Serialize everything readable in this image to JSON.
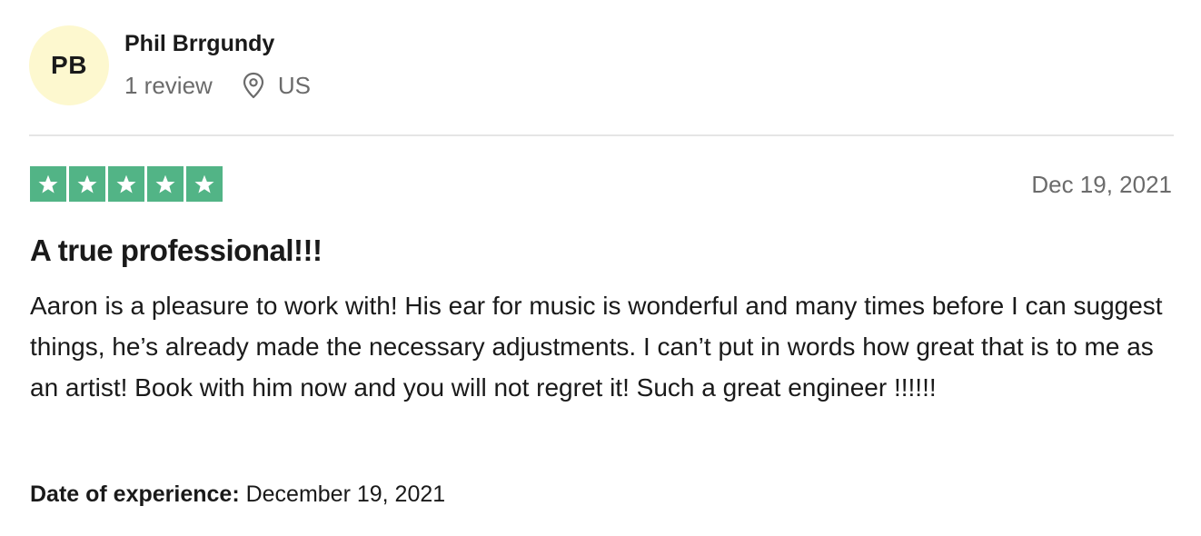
{
  "reviewer": {
    "initials": "PB",
    "name": "Phil Brrgundy",
    "review_count": "1 review",
    "location": "US",
    "avatar_color": "#fdf8cf"
  },
  "review": {
    "rating": 5,
    "rating_max": 5,
    "star_color": "#52b486",
    "date": "Dec 19, 2021",
    "title": "A true professional!!!",
    "body": "Aaron is a pleasure to work with! His ear for music is wonderful and many times before I can suggest things, he’s already made the necessary adjustments. I can’t put in words how great that is to me as an artist! Book with him now and you will not regret it! Such a great engineer !!!!!!",
    "experience_label": "Date of experience:",
    "experience_date": "December 19, 2021"
  },
  "icons": {
    "location": "location-pin-icon",
    "star": "star-icon"
  }
}
